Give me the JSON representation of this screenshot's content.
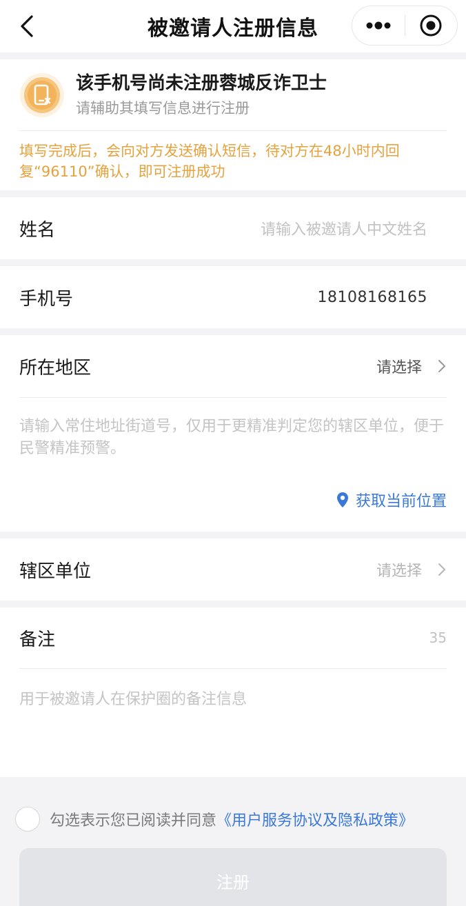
{
  "navbar": {
    "title": "被邀请人注册信息",
    "back_icon": "chevron-left-icon",
    "more_icon": "more-dots-icon",
    "close_icon": "target-circle-icon"
  },
  "notice": {
    "icon": "phone-x-icon",
    "icon_color": "#f2b35a",
    "title": "该手机号尚未注册蓉城反诈卫士",
    "subtitle": "请辅助其填写信息进行注册",
    "warning": "填写完成后，会向对方发送确认短信，待对方在48小时内回复“96110”确认，即可注册成功",
    "warning_color": "#e6a23c"
  },
  "form": {
    "name": {
      "label": "姓名",
      "placeholder": "请输入被邀请人中文姓名"
    },
    "phone": {
      "label": "手机号",
      "value": "18108168165"
    },
    "region": {
      "label": "所在地区",
      "value": "请选择"
    },
    "address": {
      "placeholder": "请输入常住地址街道号，仅用于更精准判定您的辖区单位，便于民警精准预警。"
    },
    "location": {
      "label": "获取当前位置",
      "icon": "location-pin-icon"
    },
    "jurisdiction": {
      "label": "辖区单位",
      "value": "请选择"
    },
    "remark": {
      "label": "备注",
      "count": "35",
      "placeholder": "用于被邀请人在保护圈的备注信息"
    }
  },
  "agreement": {
    "text": "勾选表示您已阅读并同意",
    "link": "《用户服务协议及隐私政策》"
  },
  "submit": {
    "label": "注册"
  },
  "colors": {
    "link": "#3a79d9",
    "accent_orange": "#e6a23c",
    "button_disabled": "#e2e4e7"
  }
}
